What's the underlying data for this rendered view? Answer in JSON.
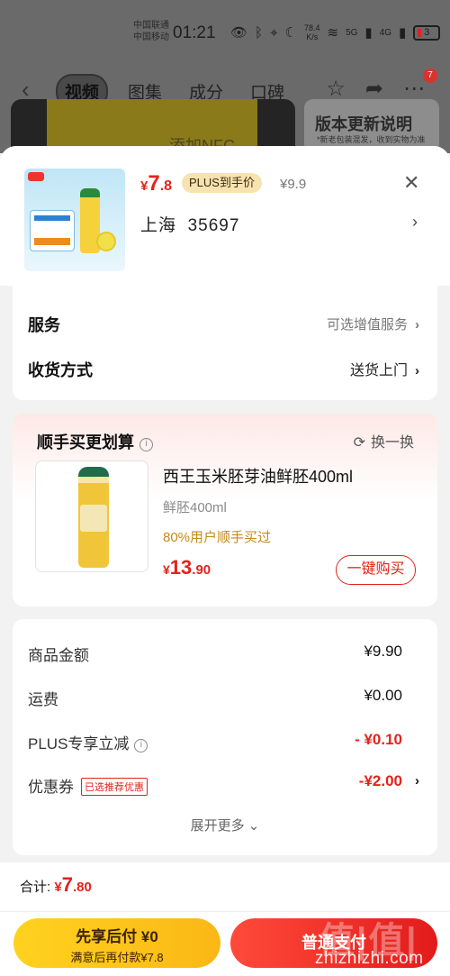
{
  "status_bar": {
    "carrier1": "中国联通",
    "carrier2": "中国移动",
    "time": "01:21",
    "net_speed_value": "78.4",
    "net_speed_unit": "K/s",
    "signal1": "5G",
    "signal2": "4G",
    "battery": "3"
  },
  "nav": {
    "tabs": [
      "视频",
      "图集",
      "成分",
      "口碑"
    ],
    "badge": "7"
  },
  "background": {
    "video_text": "添加NFC",
    "update_title": "版本更新说明",
    "update_sub": "*新老包装混发，收到实物为准"
  },
  "product": {
    "price_currency": "¥",
    "price_int": "7",
    "price_dec": ".8",
    "plus_badge": "PLUS到手价",
    "original_price": "¥9.9",
    "location_city": "上海",
    "location_code": "35697"
  },
  "service": {
    "label": "服务",
    "value": "可选增值服务"
  },
  "delivery": {
    "label": "收货方式",
    "value": "送货上门"
  },
  "bundle": {
    "title": "顺手买更划算",
    "refresh": "换一换",
    "name": "西王玉米胚芽油鲜胚400ml",
    "spec": "鲜胚400ml",
    "bought": "80%用户顺手买过",
    "price_currency": "¥",
    "price_int": "13",
    "price_dec": ".90",
    "buy_label": "一键购买"
  },
  "summary": {
    "rows": [
      {
        "label": "商品金额",
        "value": "¥9.90"
      },
      {
        "label": "运费",
        "value": "¥0.00"
      },
      {
        "label": "PLUS专享立减",
        "value": "- ¥0.10"
      },
      {
        "label": "优惠券",
        "value": "-¥2.00",
        "tag": "已选推荐优惠"
      }
    ],
    "expand": "展开更多"
  },
  "footer": {
    "total_label": "合计:",
    "total_currency": "¥",
    "total_int": "7",
    "total_dec": ".80",
    "pay_later_title": "先享后付 ¥0",
    "pay_later_sub": "满意后再付款¥7.8",
    "pay_label": "普通支付"
  },
  "watermark": {
    "logo": "值|值|值",
    "site": "zhizhizhi.com"
  },
  "colors": {
    "accent_red": "#e2231a",
    "plus_gold": "#f6e3b0",
    "pay_later_yellow": "#ffd21f"
  }
}
